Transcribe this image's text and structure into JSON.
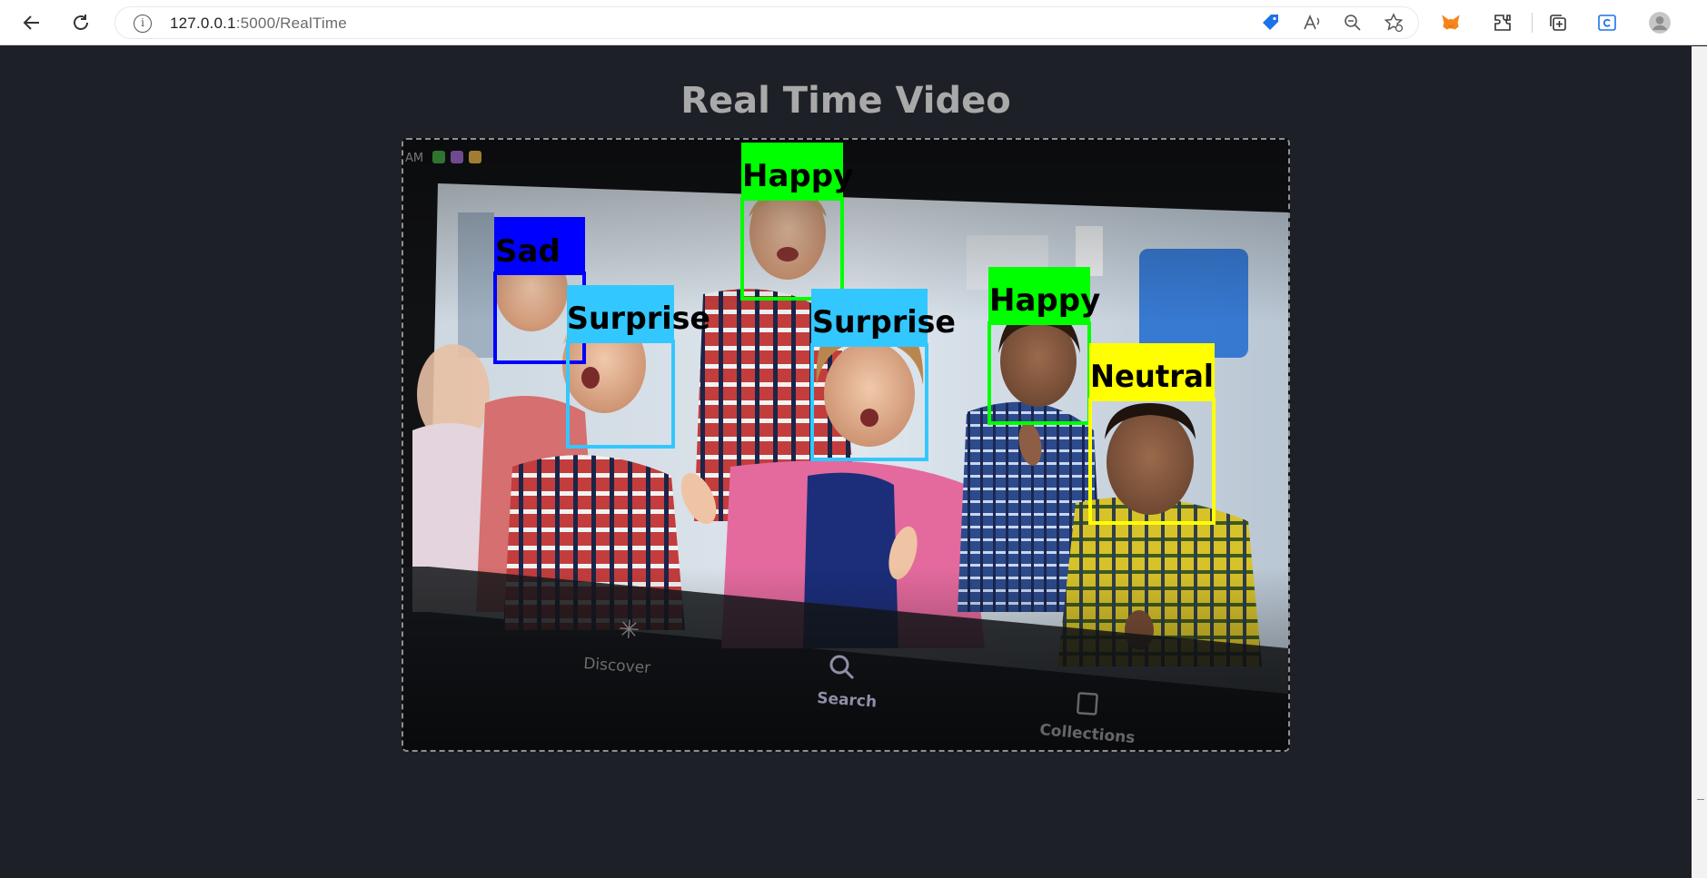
{
  "browser": {
    "url_host": "127.0.0.1",
    "url_path": ":5000/RealTime",
    "back_icon": "back-arrow-icon",
    "reload_icon": "reload-icon",
    "info_icon": "site-info-icon",
    "toolbar_icons": [
      "shopping-tag-icon",
      "read-aloud-icon",
      "zoom-out-icon",
      "add-favorite-icon",
      "metamask-fox-icon",
      "extensions-icon",
      "collections-icon",
      "edge-bar-icon",
      "profile-avatar-icon"
    ]
  },
  "page": {
    "title": "Real Time Video"
  },
  "video": {
    "detections": [
      {
        "label": "Sad",
        "color": "#0000ff"
      },
      {
        "label": "Surprise",
        "color": "#33c7ff"
      },
      {
        "label": "Happy",
        "color": "#00ff00"
      },
      {
        "label": "Surprise",
        "color": "#33c7ff"
      },
      {
        "label": "Happy",
        "color": "#00ff00"
      },
      {
        "label": "Neutral",
        "color": "#ffff00"
      }
    ],
    "tv_nav": {
      "discover": "Discover",
      "search": "Search",
      "collections": "Collections"
    }
  }
}
